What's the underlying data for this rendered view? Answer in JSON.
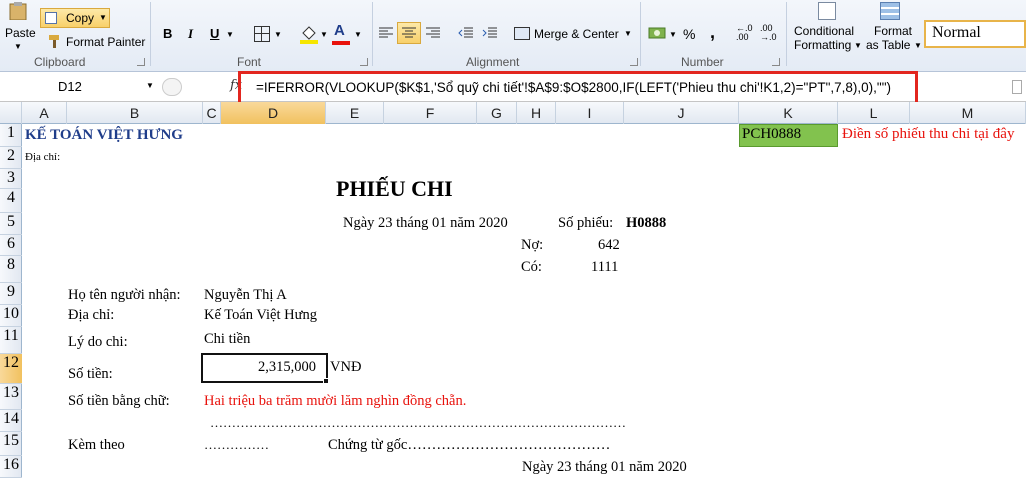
{
  "ribbon": {
    "paste_label": "Paste",
    "copy_label": "Copy",
    "format_painter_label": "Format Painter",
    "clipboard_group": "Clipboard",
    "bold": "B",
    "italic": "I",
    "underline": "U",
    "font_color_letter": "A",
    "font_group": "Font",
    "merge_label": "Merge & Center",
    "alignment_group": "Alignment",
    "currency_symbol": "$",
    "percent_symbol": "%",
    "comma_symbol": ",",
    "number_group": "Number",
    "cond_fmt_line1": "Conditional",
    "cond_fmt_line2": "Formatting",
    "format_table_line1": "Format",
    "format_table_line2": "as Table",
    "style_normal": "Normal"
  },
  "formula_bar": {
    "name_box": "D12",
    "fx": "fx",
    "formula": "=IFERROR(VLOOKUP($K$1,'Sổ quỹ chi tiết'!$A$9:$O$2800,IF(LEFT('Phieu thu chi'!K1,2)=\"PT\",7,8),0),\"\")"
  },
  "columns": [
    "A",
    "B",
    "C",
    "D",
    "E",
    "F",
    "G",
    "H",
    "I",
    "J",
    "K",
    "L",
    "M"
  ],
  "rows": [
    "1",
    "2",
    "3",
    "4",
    "5",
    "6",
    "7",
    "8",
    "9",
    "10",
    "11",
    "12",
    "13",
    "14",
    "15",
    "16"
  ],
  "sheet": {
    "company": "KẾ TOÁN VIỆT HƯNG",
    "code": "PCH0888",
    "hint": "Điền số phiếu thu chi tại đây",
    "address_label": "Địa chỉ:",
    "title": "PHIẾU CHI",
    "date_line": "Ngày 23 tháng 01 năm 2020",
    "voucher_label": "Số phiếu:",
    "voucher_value": "H0888",
    "debit_label": "Nợ:",
    "debit_value": "642",
    "credit_label": "Có:",
    "credit_value": "1111",
    "recipient_label": "Họ tên người nhận:",
    "recipient_value": "Nguyễn Thị A",
    "address2_label": "Địa chỉ:",
    "address2_value": "Kế Toán Việt Hưng",
    "reason_label": "Lý do chi:",
    "reason_value": "Chi tiền",
    "amount_label": "Số tiền:",
    "amount_value": "2,315,000",
    "currency": "VNĐ",
    "amount_words_label": "Số tiền bằng chữ:",
    "amount_words_value": "Hai triệu ba trăm mười lăm nghìn đồng chẵn.",
    "row14_dots": "……………………………………………………………………………………",
    "attach_label": "Kèm theo",
    "attach_dots": "……………",
    "source_doc_label": "Chứng từ gốc……………………………………",
    "footer_date": "Ngày 23 tháng 01 năm 2020"
  }
}
